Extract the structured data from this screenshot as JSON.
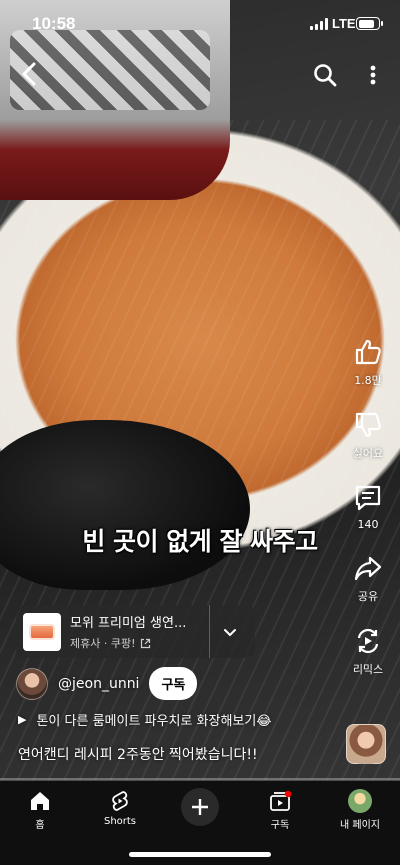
{
  "status_bar": {
    "time": "10:58",
    "network": "LTE",
    "battery_level": 0.8
  },
  "top_bar": {
    "back_icon": "chevron-left-icon",
    "search_icon": "search-icon",
    "more_icon": "more-vertical-icon"
  },
  "subtitle": "빈 곳이 없게 잘 싸주고",
  "actions": {
    "like_count": "1.8만",
    "dislike_label": "싫어요",
    "comment_count": "140",
    "share_label": "공유",
    "remix_label": "리믹스"
  },
  "product": {
    "title": "모위 프리미엄 생연...",
    "seller": "제휴사 · 쿠팡!"
  },
  "channel": {
    "handle": "@jeon_unni",
    "subscribe_label": "구독"
  },
  "music_title": "톤이 다른 룸메이트 파우치로 화장해보기😂",
  "description": "연어캔디 레시피 2주동안 찍어봤습니다!!",
  "progress": 0.0,
  "colors": {
    "accent": "#ff0000",
    "nav_bg": "#0f0f0f",
    "subscribe_bg": "#ffffff"
  },
  "nav": {
    "home": "홈",
    "shorts": "Shorts",
    "create_icon": "plus-icon",
    "subscriptions": "구독",
    "profile": "내 페이지"
  }
}
